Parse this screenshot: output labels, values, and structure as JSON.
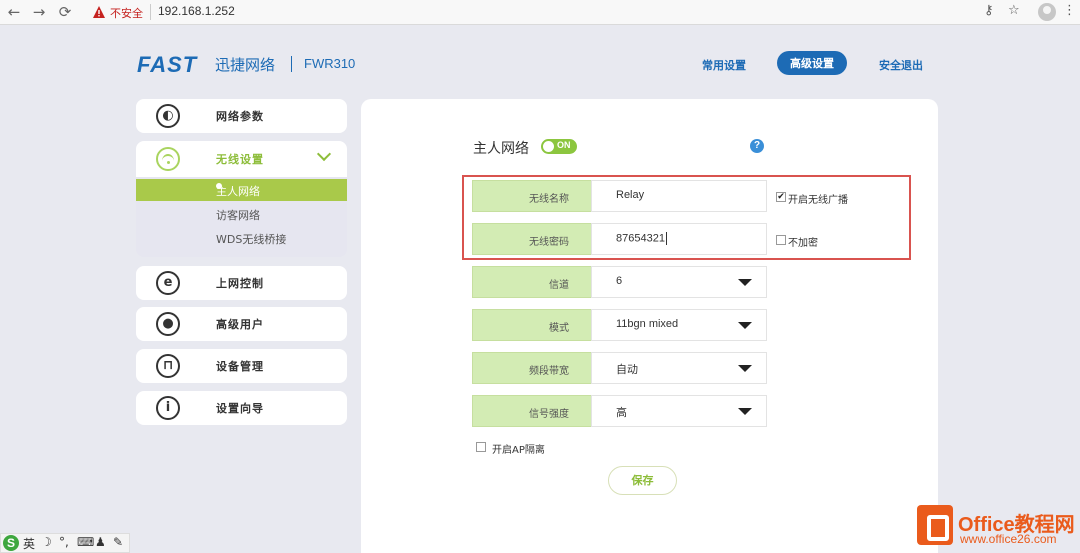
{
  "browser": {
    "back_icon": "←",
    "forward_icon": "→",
    "reload_icon": "⟳",
    "insecure_label": "不安全",
    "url": "192.168.1.252",
    "key_icon": "⚷",
    "star_icon": "☆",
    "menu_icon": "⋮"
  },
  "header": {
    "logo": "FAST",
    "brand_cn": "迅捷网络",
    "model": "FWR310",
    "nav": [
      "常用设置",
      "高级设置",
      "安全退出"
    ],
    "active_nav": "高级设置"
  },
  "sidebar": {
    "items": [
      {
        "label": "网络参数",
        "icon": "globe-icon",
        "glyph": "◐"
      },
      {
        "label": "无线设置",
        "icon": "wifi-icon"
      },
      {
        "label": "上网控制",
        "icon": "e-icon",
        "glyph": "e"
      },
      {
        "label": "高级用户",
        "icon": "user-icon",
        "glyph": "●"
      },
      {
        "label": "设备管理",
        "icon": "router-icon",
        "glyph": "⊓"
      },
      {
        "label": "设置向导",
        "icon": "info-icon",
        "glyph": "i"
      }
    ],
    "subitems": [
      "主人网络",
      "访客网络",
      "WDS无线桥接"
    ],
    "active_subitem": "主人网络"
  },
  "main": {
    "title": "主人网络",
    "toggle_text": "ON",
    "help_icon": "?",
    "ssid_label": "无线名称",
    "ssid_value": "Relay",
    "broadcast_label": "开启无线广播",
    "broadcast_checked": true,
    "password_label": "无线密码",
    "password_value": "87654321",
    "no_encrypt_label": "不加密",
    "no_encrypt_checked": false,
    "channel_label": "信道",
    "channel_value": "6",
    "mode_label": "模式",
    "mode_value": "11bgn mixed",
    "bandwidth_label": "频段带宽",
    "bandwidth_value": "自动",
    "signal_label": "信号强度",
    "signal_value": "高",
    "ap_isolation_label": "开启AP隔离",
    "save_label": "保存"
  },
  "watermark": {
    "text": "Office教程网",
    "url": "www.office26.com"
  },
  "ime": {
    "s": "S",
    "lang": "英",
    "items": [
      "☽",
      "°,",
      "⌨",
      "♟",
      "✎"
    ]
  },
  "colors": {
    "brand_blue": "#1d6bb5",
    "accent_green": "#8cc63f",
    "label_green": "#d3ecb4",
    "highlight_red": "#d9534f",
    "watermark_orange": "#ea5b1c"
  }
}
